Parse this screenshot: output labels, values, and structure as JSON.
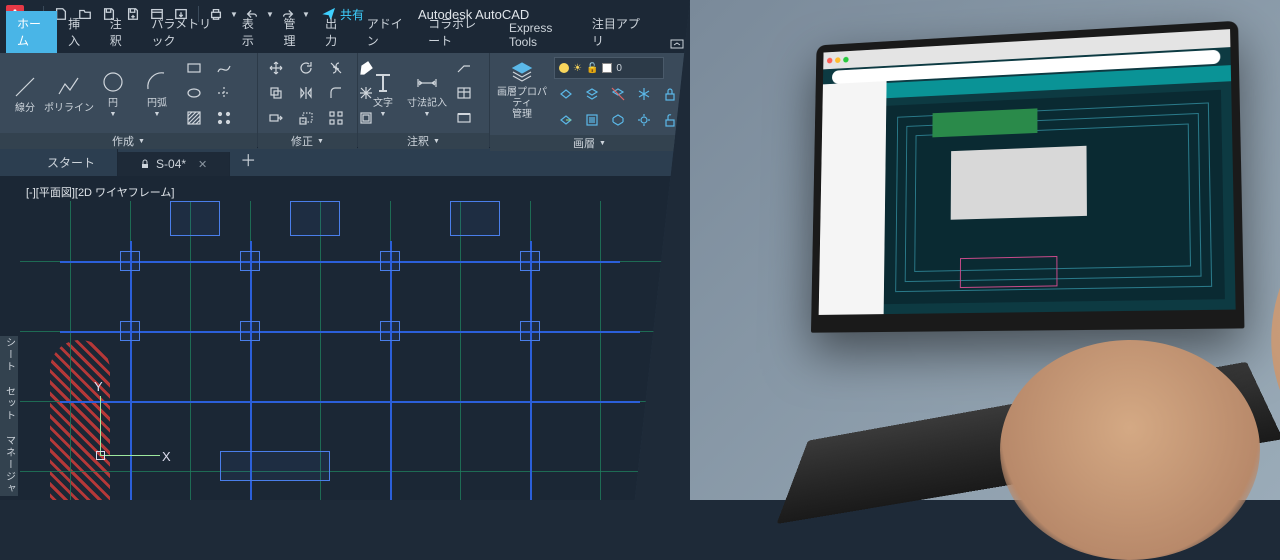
{
  "app": {
    "title": "Autodesk AutoCAD",
    "icon_letter": "A"
  },
  "qat": {
    "share_label": "共有"
  },
  "ribbon_tabs": [
    "ホーム",
    "挿入",
    "注釈",
    "パラメトリック",
    "表示",
    "管理",
    "出力",
    "アドイン",
    "コラボレート",
    "Express Tools",
    "注目アプリ"
  ],
  "ribbon_active": 0,
  "panels": {
    "create": {
      "title": "作成",
      "buttons": {
        "line": "線分",
        "polyline": "ポリライン",
        "circle": "円",
        "arc": "円弧"
      }
    },
    "modify": {
      "title": "修正"
    },
    "annot": {
      "title": "注釈",
      "text": "文字",
      "dim": "寸法記入"
    },
    "layers": {
      "title": "画層",
      "props": "画層プロパティ\n管理",
      "combo_value": "0"
    }
  },
  "file_tabs": {
    "start": "スタート",
    "file": "S-04*",
    "locked": true
  },
  "viewport": {
    "label": "[-][平面図][2D ワイヤフレーム]",
    "ucs_x": "X",
    "ucs_y": "Y"
  },
  "side_panel": "シート セット マネージャ"
}
